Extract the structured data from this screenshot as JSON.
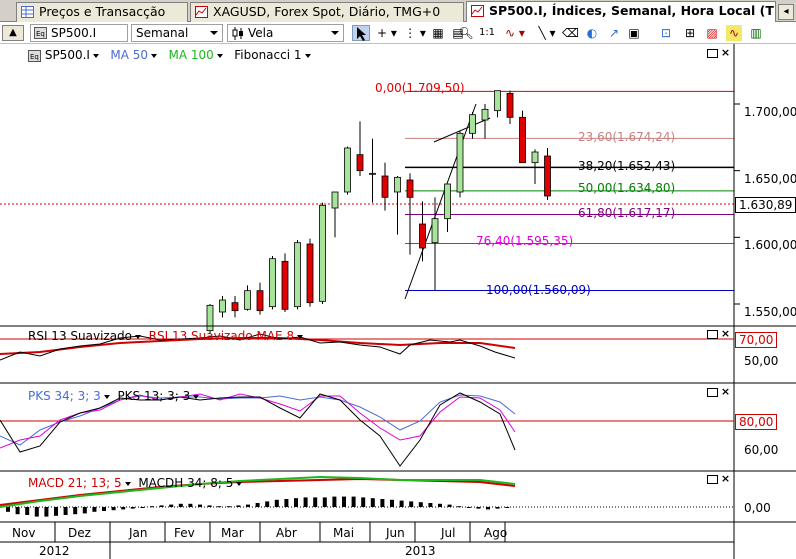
{
  "tabs": [
    {
      "label": "Preços e Transacção",
      "active": false
    },
    {
      "label": "XAGUSD, Forex Spot, Diário, TMG+0",
      "active": false
    },
    {
      "label": "SP500.I, Índices, Semanal, Hora Local (T",
      "active": true
    }
  ],
  "toolbar": {
    "symbol": "SP500.I",
    "period": "Semanal",
    "chart_type": "Vela",
    "cursor_icon": "arrow-cursor-icon",
    "tools": [
      "crosshair-icon",
      "grid-icon",
      "table-icon",
      "zoom-in-icon",
      "zoom-out-icon",
      "draw-icon",
      "line-icon",
      "eraser-icon",
      "color-icon",
      "text-icon",
      "image-icon",
      "settings-icon",
      "chart-icon"
    ]
  },
  "legend": {
    "symbol": "SP500.I",
    "ma50": "MA 50",
    "ma100": "MA 100",
    "fibonacci": "Fibonacci 1"
  },
  "colors": {
    "ma50": "#4a6cd4",
    "ma100": "#1db81d",
    "bull": "#a7e39a",
    "bear": "#e00000",
    "fib0": "#e00000",
    "fib236": "#c88080",
    "fib382": "#000000",
    "fib50": "#008000",
    "fib618": "#800080",
    "fib764": "#e000e0",
    "fib100": "#0000c0"
  },
  "price_axis": {
    "ticks": [
      "1.700,00",
      "1.650,00",
      "1.600,00",
      "1.550,00"
    ],
    "current": "1.630,89"
  },
  "fibonacci": [
    {
      "label": "0,00(1.709,50)",
      "pct": 0,
      "price": 1709.5
    },
    {
      "label": "23,60(1.674,24)",
      "pct": 23.6,
      "price": 1674.24
    },
    {
      "label": "38,20(1.652,43)",
      "pct": 38.2,
      "price": 1652.43
    },
    {
      "label": "50,00(1.634,80)",
      "pct": 50,
      "price": 1634.8
    },
    {
      "label": "61,80(1.617,17)",
      "pct": 61.8,
      "price": 1617.17
    },
    {
      "label": "76,40(1.595,35)",
      "pct": 76.4,
      "price": 1595.35
    },
    {
      "label": "100,00(1.560,09)",
      "pct": 100,
      "price": 1560.09
    }
  ],
  "rsi_panel": {
    "title": "RSI 13 Suavizado",
    "title2": "RSI 13 Suavizado MAE 8",
    "level_high": "70,00",
    "level_low": "50,00"
  },
  "pks_panel": {
    "title": "PKS 34; 3; 3",
    "title2": "PKS 13; 3; 3",
    "level_high": "80,00",
    "level_low": "60,00"
  },
  "macd_panel": {
    "title": "MACD 21; 13; 5",
    "title2": "MACDH 34; 8; 5",
    "level": "0,00"
  },
  "months": [
    "Nov",
    "Dez",
    "Jan",
    "Fev",
    "Mar",
    "Abr",
    "Mai",
    "Jun",
    "Jul",
    "Ago"
  ],
  "years": [
    "2012",
    "2013"
  ],
  "chart_data": {
    "type": "candlestick",
    "period": "weekly",
    "candles": [
      {
        "o": 1530,
        "h": 1550,
        "l": 1528,
        "c": 1549
      },
      {
        "o": 1544,
        "h": 1556,
        "l": 1540,
        "c": 1553
      },
      {
        "o": 1551,
        "h": 1556,
        "l": 1540,
        "c": 1545
      },
      {
        "o": 1546,
        "h": 1564,
        "l": 1545,
        "c": 1560
      },
      {
        "o": 1560,
        "h": 1566,
        "l": 1542,
        "c": 1545
      },
      {
        "o": 1548,
        "h": 1586,
        "l": 1546,
        "c": 1584
      },
      {
        "o": 1582,
        "h": 1588,
        "l": 1544,
        "c": 1546
      },
      {
        "o": 1548,
        "h": 1598,
        "l": 1546,
        "c": 1596
      },
      {
        "o": 1595,
        "h": 1599,
        "l": 1548,
        "c": 1551
      },
      {
        "o": 1552,
        "h": 1626,
        "l": 1550,
        "c": 1624
      },
      {
        "o": 1622,
        "h": 1634,
        "l": 1600,
        "c": 1634
      },
      {
        "o": 1634,
        "h": 1668,
        "l": 1632,
        "c": 1667
      },
      {
        "o": 1662,
        "h": 1687,
        "l": 1646,
        "c": 1650
      },
      {
        "o": 1648,
        "h": 1674,
        "l": 1626,
        "c": 1648
      },
      {
        "o": 1646,
        "h": 1656,
        "l": 1620,
        "c": 1630
      },
      {
        "o": 1634,
        "h": 1646,
        "l": 1602,
        "c": 1645
      },
      {
        "o": 1643,
        "h": 1648,
        "l": 1587,
        "c": 1630
      },
      {
        "o": 1610,
        "h": 1627,
        "l": 1582,
        "c": 1592
      },
      {
        "o": 1596,
        "h": 1630,
        "l": 1560,
        "c": 1614
      },
      {
        "o": 1614,
        "h": 1640,
        "l": 1604,
        "c": 1640
      },
      {
        "o": 1634,
        "h": 1680,
        "l": 1630,
        "c": 1678
      },
      {
        "o": 1678,
        "h": 1694,
        "l": 1674,
        "c": 1692
      },
      {
        "o": 1688,
        "h": 1700,
        "l": 1674,
        "c": 1696
      },
      {
        "o": 1695,
        "h": 1710,
        "l": 1690,
        "c": 1710
      },
      {
        "o": 1708,
        "h": 1710,
        "l": 1685,
        "c": 1690
      },
      {
        "o": 1690,
        "h": 1695,
        "l": 1656,
        "c": 1656
      },
      {
        "o": 1656,
        "h": 1666,
        "l": 1640,
        "c": 1664
      },
      {
        "o": 1661,
        "h": 1667,
        "l": 1628,
        "c": 1631
      }
    ],
    "ylim": [
      1535,
      1720
    ]
  }
}
